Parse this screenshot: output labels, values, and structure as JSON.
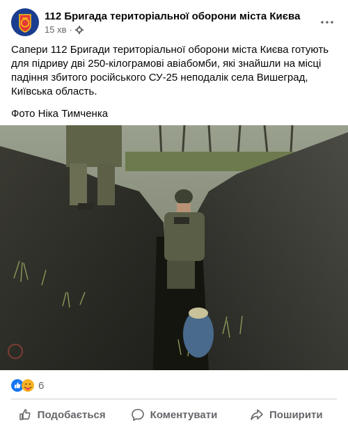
{
  "header": {
    "page_name": "112 Бригада територіальної оборони міста Києва",
    "time": "15 хв",
    "audience_icon": "gear-icon",
    "more_icon": "more-dots-icon"
  },
  "post": {
    "paragraph1": "Сапери 112 Бригади територіальної оборони міста Києва готують для підриву дві 250-кілограмові авіабомби, які  знайшли на місці падіння збитого російського СУ-25 неподалік села Вишеград, Київська область.",
    "paragraph2": "Фото Ніка Тимченка"
  },
  "reactions": {
    "icons": [
      "like-icon",
      "care-icon"
    ],
    "count": "6"
  },
  "actions": {
    "like": "Подобається",
    "comment": "Коментувати",
    "share": "Поширити"
  },
  "colors": {
    "like_blue": "#1877f2",
    "secondary_text": "#65676b",
    "divider": "#ced0d4"
  }
}
